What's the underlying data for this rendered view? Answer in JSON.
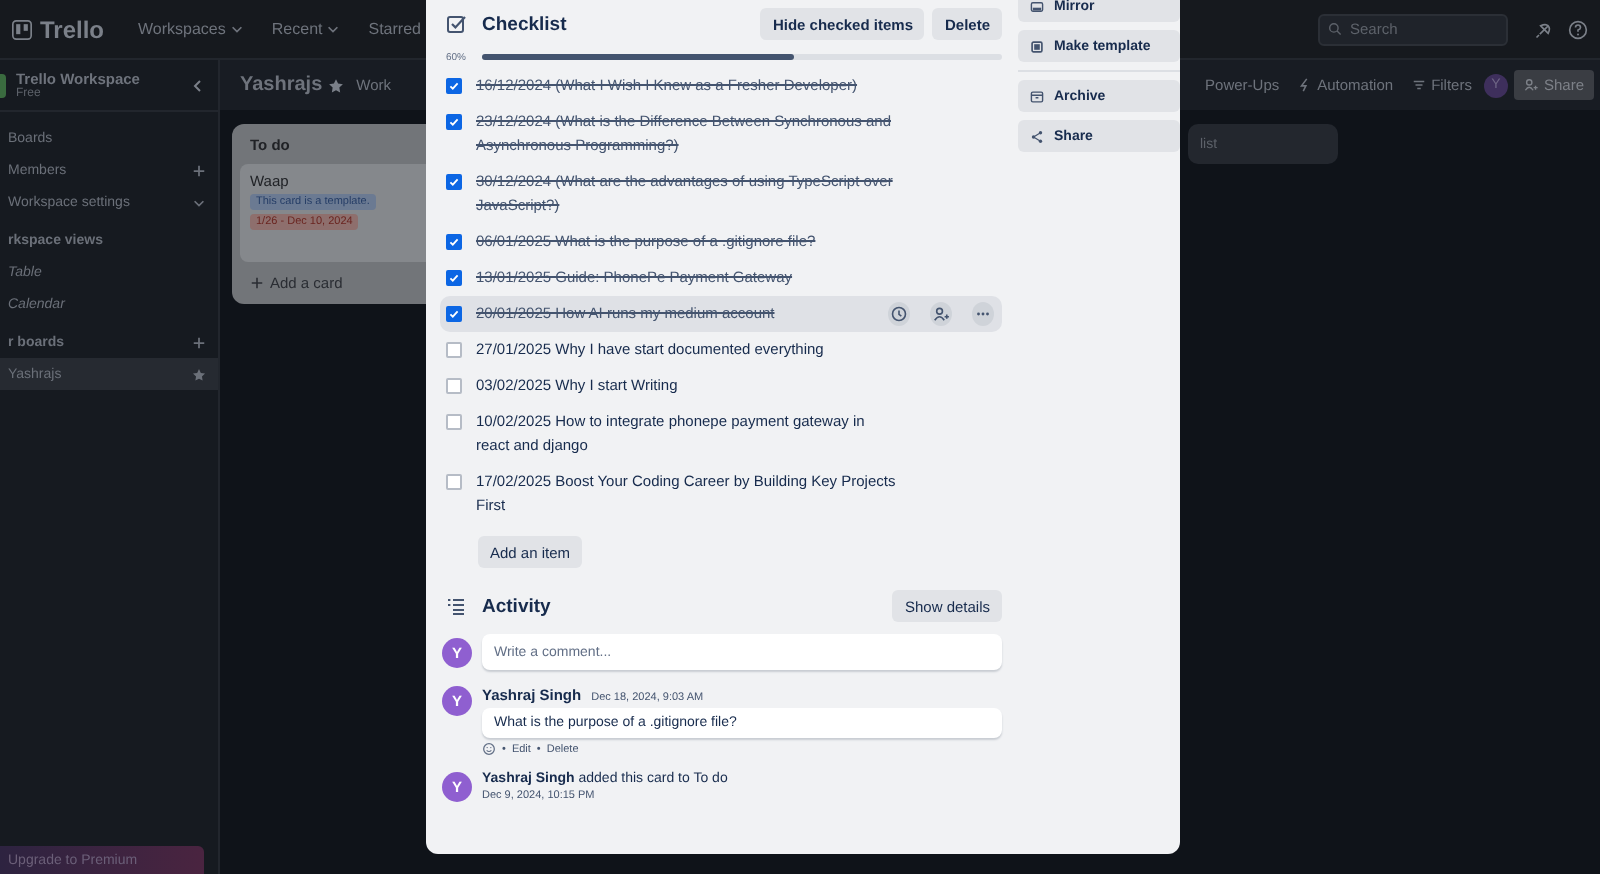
{
  "top_nav": {
    "logo": "Trello",
    "menus": [
      {
        "label": "Workspaces"
      },
      {
        "label": "Recent"
      },
      {
        "label": "Starred"
      }
    ],
    "search": {
      "placeholder": "Search"
    }
  },
  "sidebar": {
    "workspace_name": "Trello Workspace",
    "plan": "Free",
    "items": [
      {
        "label": "Boards",
        "kind": "plain"
      },
      {
        "label": "Members",
        "kind": "add"
      },
      {
        "label": "Workspace settings",
        "kind": "expand"
      }
    ],
    "views_heading": "rkspace views",
    "views": [
      {
        "label": "Table"
      },
      {
        "label": "Calendar"
      }
    ],
    "boards_heading": "r boards",
    "boards": [
      {
        "label": "Yashrajs",
        "selected": true
      }
    ],
    "upgrade": "Upgrade to Premium"
  },
  "board": {
    "title": "Yashrajs",
    "workspace_button": "Work",
    "actions": [
      {
        "label": "Power-Ups",
        "kind": "plain"
      },
      {
        "label": "Automation",
        "kind": "automation"
      },
      {
        "label": "Filters",
        "kind": "filter"
      }
    ],
    "avatar": "Y",
    "share": "Share",
    "lists": [
      {
        "title": "To do",
        "cards": [
          {
            "title": "Waap",
            "badges": [
              {
                "kind": "template",
                "text": "This card is a template."
              },
              {
                "kind": "due",
                "text": "1/26 - Dec 10, 2024"
              }
            ]
          }
        ],
        "add_card": "Add a card"
      }
    ],
    "add_list": "list"
  },
  "card_modal": {
    "side_actions": [
      {
        "label": "Mirror",
        "kind": "mirror"
      },
      {
        "label": "Make template",
        "kind": "template"
      },
      {
        "label": "Archive",
        "kind": "archive"
      },
      {
        "label": "Share",
        "kind": "share"
      }
    ],
    "checklist": {
      "title": "Checklist",
      "buttons": [
        "Hide checked items",
        "Delete"
      ],
      "percent": "60%",
      "level": 0.6,
      "items": [
        {
          "text": "16/12/2024 (What I Wish I Knew as a Fresher Developer)",
          "checked": true,
          "hovered": false
        },
        {
          "text": "23/12/2024 (What is the Difference Between Synchronous and Asynchronous Programming?)",
          "checked": true,
          "hovered": false
        },
        {
          "text": "30/12/2024 (What are the advantages of using TypeScript over JavaScript?)",
          "checked": true,
          "hovered": false
        },
        {
          "text": "06/01/2025 What is the purpose of a .gitignore file?",
          "checked": true,
          "hovered": false
        },
        {
          "text": "13/01/2025 Guide: PhonePe Payment Gateway",
          "checked": true,
          "hovered": false
        },
        {
          "text": "20/01/2025 How AI runs my medium account",
          "checked": true,
          "hovered": true
        },
        {
          "text": "27/01/2025 Why I have start documented everything",
          "checked": false,
          "hovered": false
        },
        {
          "text": "03/02/2025 Why I start Writing",
          "checked": false,
          "hovered": false
        },
        {
          "text": "10/02/2025 How to integrate phonepe payment gateway in react and django",
          "checked": false,
          "hovered": false
        },
        {
          "text": "17/02/2025 Boost Your Coding Career by Building Key Projects First",
          "checked": false,
          "hovered": false
        }
      ],
      "add_item": "Add an item"
    },
    "activity": {
      "title": "Activity",
      "show_details": "Show details",
      "avatar": "Y",
      "comment_placeholder": "Write a comment...",
      "entries": [
        {
          "kind": "comment",
          "avatar": "Y",
          "author": "Yashraj Singh",
          "time": "Dec 18, 2024, 9:03 AM",
          "text": "What is the purpose of a .gitignore file?",
          "separator": "•",
          "actions": [
            "Edit",
            "Delete"
          ]
        },
        {
          "kind": "event",
          "avatar": "Y",
          "text": "**Yashraj Singh** added this card to To do",
          "time": "Dec 9, 2024, 10:15 PM"
        }
      ]
    }
  }
}
